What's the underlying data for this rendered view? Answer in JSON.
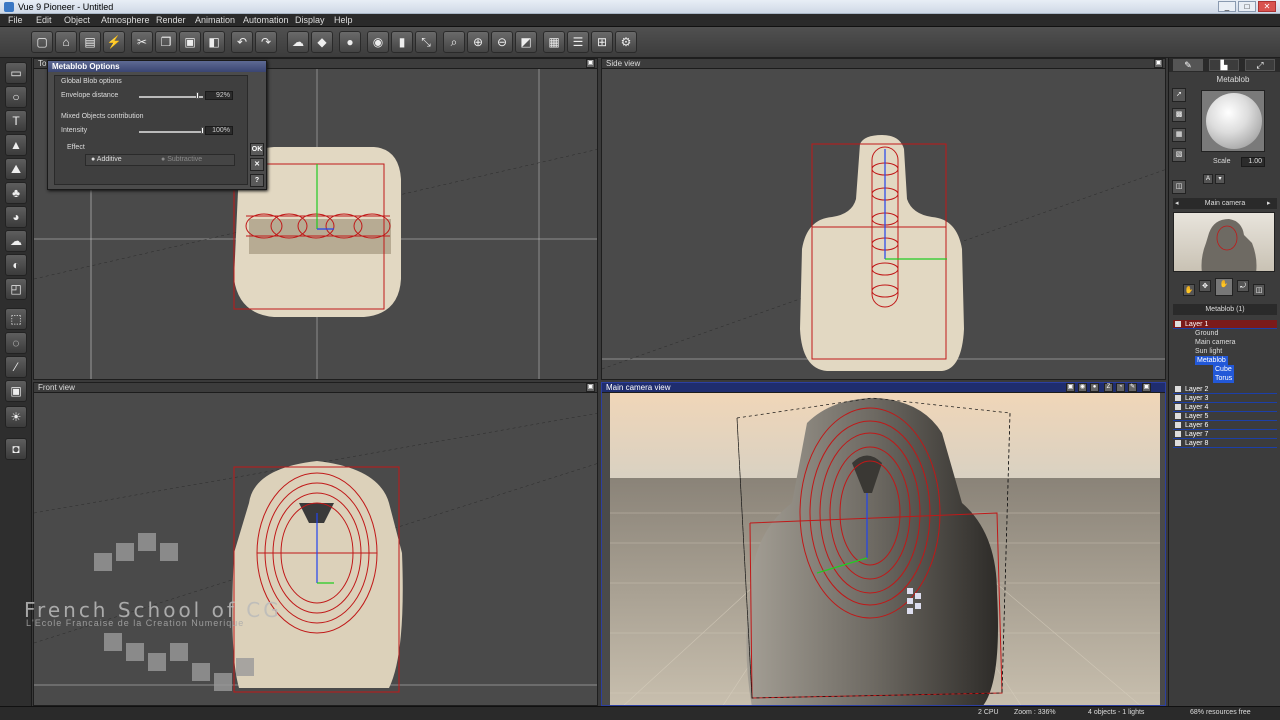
{
  "window": {
    "title": "Vue 9 Pioneer - Untitled",
    "minimize": "_",
    "maximize": "□",
    "close": "✕"
  },
  "menu": [
    "File",
    "Edit",
    "Object",
    "Atmosphere",
    "Render",
    "Animation",
    "Automation",
    "Display",
    "Help"
  ],
  "toolbar_icons": [
    "new-icon",
    "open-icon",
    "save-icon",
    "save-as-icon",
    "cut-icon",
    "copy-icon",
    "paste-icon",
    "group-icon",
    "undo-icon",
    "redo-icon",
    "atmosphere-icon",
    "materials-icon",
    "objects-icon",
    "render-icon",
    "link-icon",
    "center-icon",
    "zoom-icon",
    "zoom-in-icon",
    "zoom-out-icon",
    "frame-icon",
    "film-icon",
    "timeline-icon",
    "viewports-icon",
    "options-icon"
  ],
  "left_tools": [
    "select-icon",
    "sphere-icon",
    "text-icon",
    "terrain-icon",
    "mountain-icon",
    "plant-icon",
    "rock-icon",
    "cloud-icon",
    "metablob-icon",
    "cube-icon",
    "paint-icon",
    "wire-icon",
    "bone-icon",
    "camera-icon",
    "light-icon",
    "export-icon"
  ],
  "viewports": {
    "top": {
      "title": "Top view"
    },
    "side": {
      "title": "Side view"
    },
    "front": {
      "title": "Front view"
    },
    "camera": {
      "title": "Main camera view"
    }
  },
  "metablob_options": {
    "title": "Metablob Options",
    "group_label": "Global Blob options",
    "envelope_label": "Envelope distance",
    "envelope_value": "92%",
    "envelope_fraction": 0.92,
    "mixed_label": "Mixed Objects contribution",
    "intensity_label": "Intensity",
    "intensity_value": "100%",
    "intensity_fraction": 1.0,
    "effect_label": "Effect",
    "additive_label": "Additive",
    "subtractive_label": "Subtractive",
    "ok_label": "OK",
    "cancel_label": "✕",
    "help_label": "?"
  },
  "right_panel": {
    "tabs": [
      "✎",
      "▙",
      "⤢"
    ],
    "material_name": "Metablob",
    "scale_label": "Scale",
    "scale_value": "1.00",
    "a_label": "A",
    "camera_label": "Main camera",
    "object_header": "Metablob (1)",
    "tree": [
      {
        "label": "Layer 1",
        "level": 0,
        "selected": false
      },
      {
        "label": "Ground",
        "level": 1,
        "selected": false
      },
      {
        "label": "Main camera",
        "level": 1,
        "selected": false
      },
      {
        "label": "Sun light",
        "level": 1,
        "selected": false
      },
      {
        "label": "Metablob",
        "level": 1,
        "selected": true
      },
      {
        "label": "Cube",
        "level": 2,
        "selected": true
      },
      {
        "label": "Torus",
        "level": 2,
        "selected": true
      }
    ],
    "layers": [
      "Layer 2",
      "Layer 3",
      "Layer 4",
      "Layer 5",
      "Layer 6",
      "Layer 7",
      "Layer 8"
    ]
  },
  "status": {
    "cpu": "2 CPU",
    "zoom": "Zoom : 336%",
    "objects": "4 objects - 1 lights",
    "resources": "68% resources free"
  },
  "watermark": {
    "title": "French School of CG",
    "subtitle": "L'Ecole Francaise de la Creation Numerique"
  },
  "colors": {
    "selection": "#2258d8",
    "wireframe": "#cc1a1a",
    "active_viewport": "#1f2d6e"
  }
}
